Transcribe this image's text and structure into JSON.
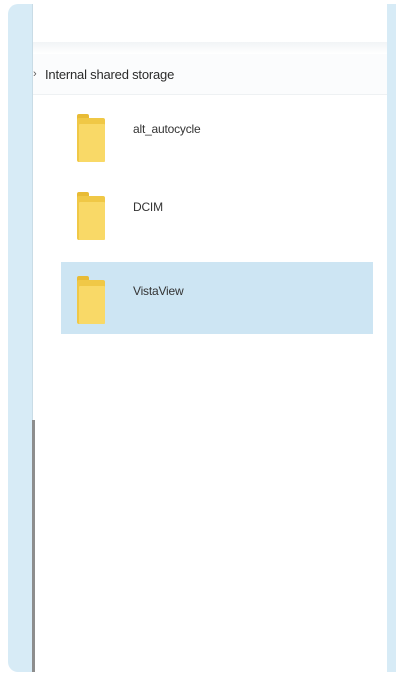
{
  "breadcrumb": {
    "separator_icon": "chevron-right-icon",
    "label": "Internal shared storage"
  },
  "files": [
    {
      "name": "alt_autocycle",
      "icon": "folder-icon",
      "selected": false
    },
    {
      "name": "DCIM",
      "icon": "folder-icon",
      "selected": false
    },
    {
      "name": "VistaView",
      "icon": "folder-icon",
      "selected": true
    }
  ],
  "colors": {
    "selection": "#cde5f3",
    "folder": "#f9d967",
    "bezel": "#d7ebf6"
  }
}
